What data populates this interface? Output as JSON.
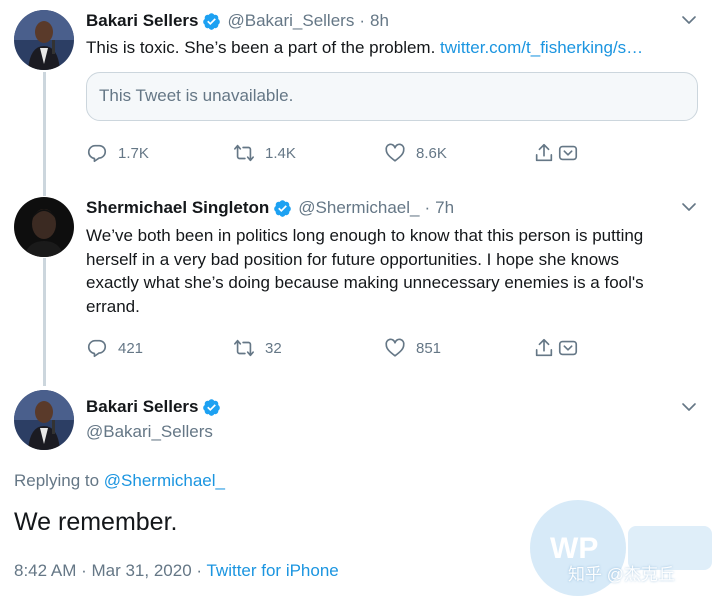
{
  "tweet1": {
    "name": "Bakari Sellers",
    "handle": "@Bakari_Sellers",
    "time": "8h",
    "text": "This is toxic. She’s been a part of the problem. ",
    "link": "twitter.com/t_fisherking/s…",
    "quote": "This Tweet is unavailable.",
    "replies": "1.7K",
    "retweets": "1.4K",
    "likes": "8.6K"
  },
  "tweet2": {
    "name": "Shermichael Singleton",
    "handle": "@Shermichael_",
    "time": "7h",
    "lines": [
      "We’ve both been in politics long enough to know that this person is putting",
      "herself in a very bad position for future opportunities. I hope she knows",
      "exactly what she’s doing because making unnecessary enemies is a fool's",
      "errand."
    ],
    "replies": "421",
    "retweets": "32",
    "likes": "851"
  },
  "tweet3": {
    "name": "Bakari Sellers",
    "handle": "@Bakari_Sellers",
    "replying_prefix": "Replying to ",
    "replying_to": "@Shermichael_",
    "text": "We remember.",
    "datetime": "8:42 AM · Mar 31, 2020 · ",
    "source": "Twitter for iPhone"
  },
  "separator": "·",
  "watermark": {
    "text": "知乎 @杰克丘"
  },
  "colors": {
    "accent": "#1b95e0",
    "muted": "#657786",
    "verified": "#1da1f2",
    "thread_line": "#ccd6dd"
  }
}
